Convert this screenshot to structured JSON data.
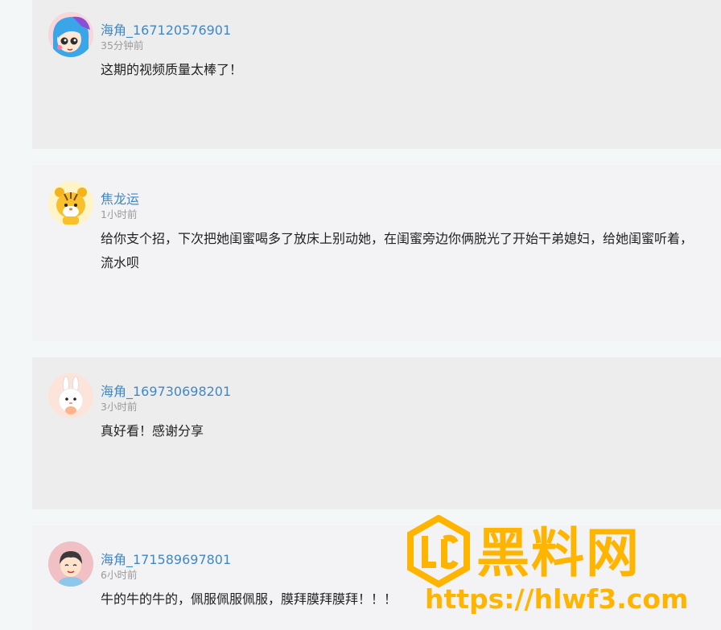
{
  "comments": [
    {
      "username": "海角_167120576901",
      "time": "35分钟前",
      "content": "这期的视频质量太棒了！",
      "avatar_icon": "anime-girl-avatar-icon"
    },
    {
      "username": "焦龙运",
      "time": "1小时前",
      "content_line1": "给你支个招，下次把她闺蜜喝多了放床上别动她，在闺蜜旁边你俩脱光了开始干弟媳妇，给她闺蜜听着，",
      "content_line2": "流水呗",
      "avatar_icon": "tiger-avatar-icon"
    },
    {
      "username": "海角_169730698201",
      "time": "3小时前",
      "content": "真好看！感谢分享",
      "avatar_icon": "bunny-avatar-icon"
    },
    {
      "username": "海角_171589697801",
      "time": "6小时前",
      "content": "牛的牛的牛的，佩服佩服佩服，膜拜膜拜膜拜！！！",
      "avatar_icon": "boy-avatar-icon"
    }
  ],
  "watermark": {
    "title": "黑料网",
    "url": "https://hlwf3.com",
    "color": "#ffb400"
  }
}
